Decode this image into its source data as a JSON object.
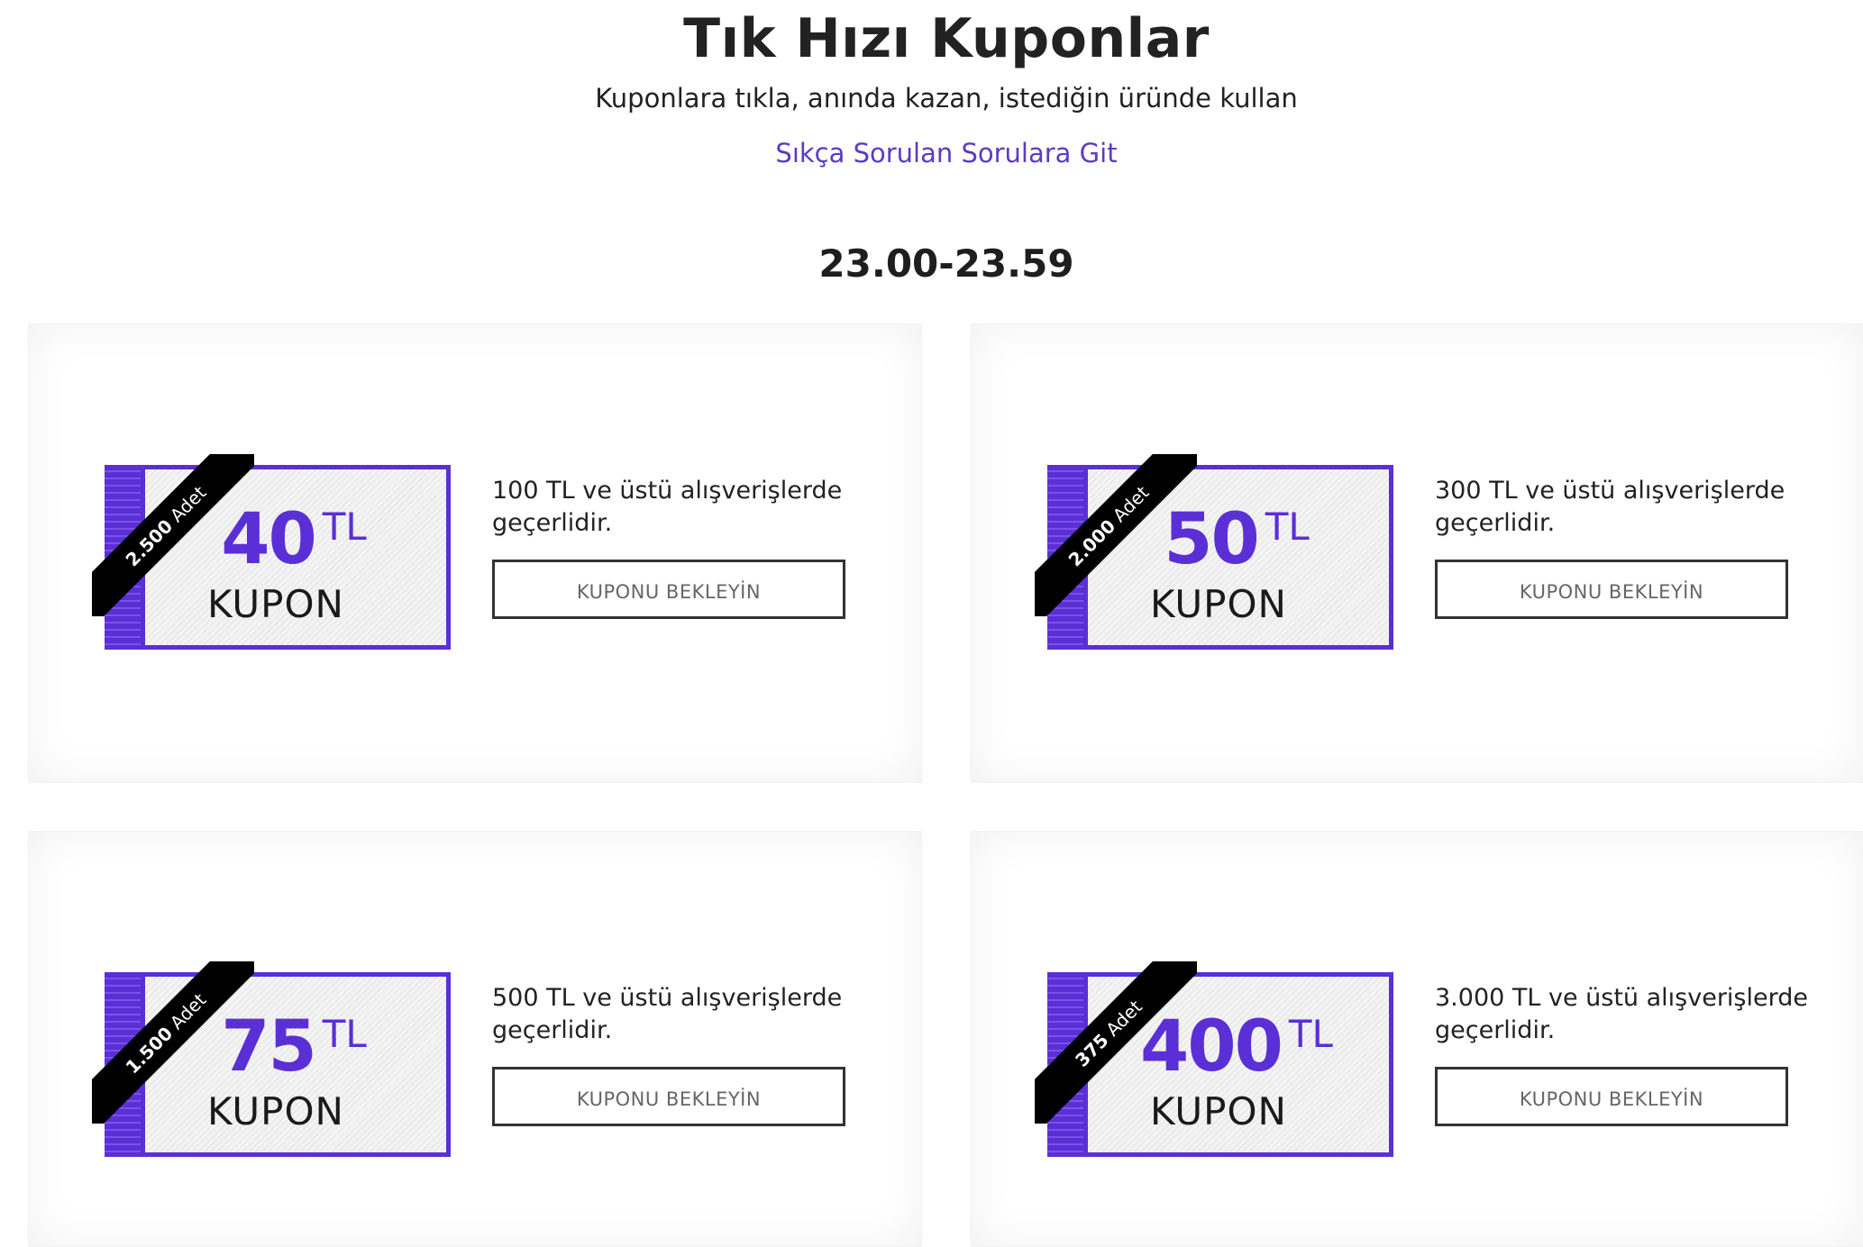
{
  "header": {
    "title": "Tık Hızı Kuponlar",
    "subtitle": "Kuponlara tıkla, anında kazan, istediğin üründe kullan",
    "faq_link": "Sıkça Sorulan Sorulara Git"
  },
  "time_slot": "23.00-23.59",
  "colors": {
    "accent": "#5b2fd6",
    "link": "#5b3bc4",
    "ribbon": "#000000"
  },
  "coupons": [
    {
      "amount": "40",
      "currency": "TL",
      "label": "KUPON",
      "count": "2.500",
      "count_unit": "Adet",
      "description": "100 TL ve üstü alışverişlerde geçerlidir.",
      "button_label": "KUPONU BEKLEYİN"
    },
    {
      "amount": "50",
      "currency": "TL",
      "label": "KUPON",
      "count": "2.000",
      "count_unit": "Adet",
      "description": "300 TL ve üstü alışverişlerde geçerlidir.",
      "button_label": "KUPONU BEKLEYİN"
    },
    {
      "amount": "75",
      "currency": "TL",
      "label": "KUPON",
      "count": "1.500",
      "count_unit": "Adet",
      "description": "500 TL ve üstü alışverişlerde geçerlidir.",
      "button_label": "KUPONU BEKLEYİN"
    },
    {
      "amount": "400",
      "currency": "TL",
      "label": "KUPON",
      "count": "375",
      "count_unit": "Adet",
      "description": "3.000 TL ve üstü alışverişlerde geçerlidir.",
      "button_label": "KUPONU BEKLEYİN"
    }
  ]
}
